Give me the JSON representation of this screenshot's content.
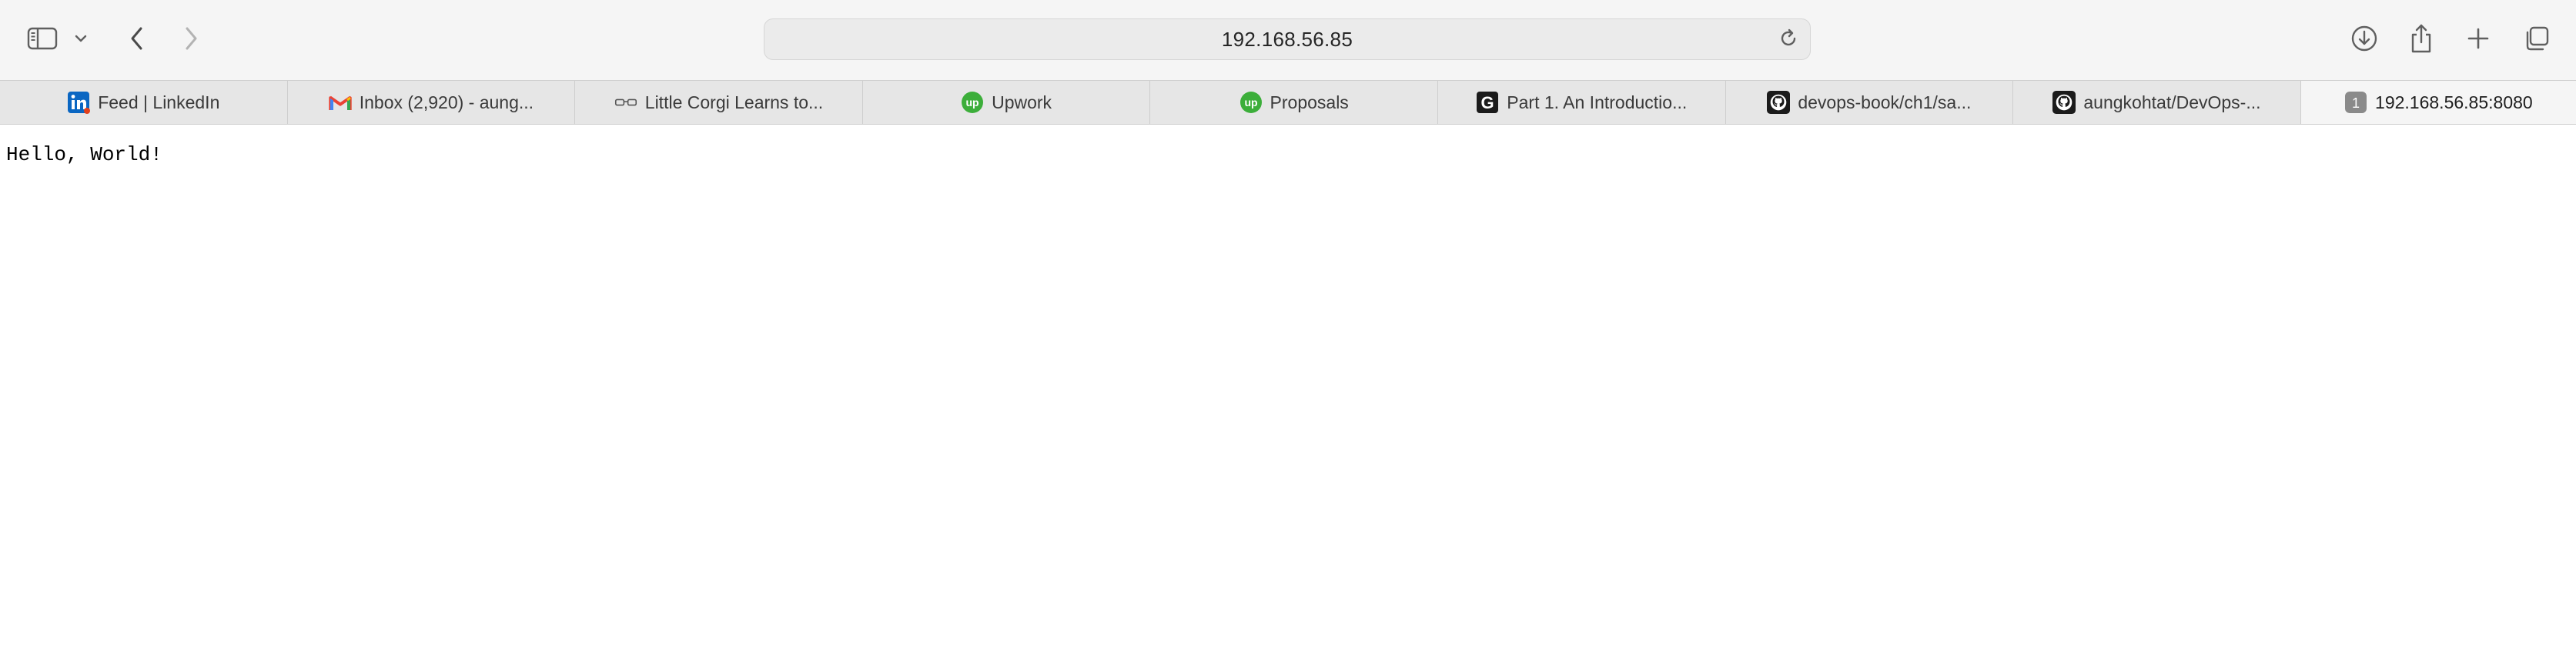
{
  "toolbar": {
    "sidebar_icon": "sidebar-icon",
    "sidebar_menu_icon": "chevron-down-icon",
    "back_icon": "chevron-left-icon",
    "forward_icon": "chevron-right-icon",
    "download_icon": "download-icon",
    "share_icon": "share-icon",
    "new_tab_icon": "plus-icon",
    "tab_overview_icon": "tab-overview-icon"
  },
  "address_bar": {
    "url": "192.168.56.85",
    "reload_icon": "reload-icon"
  },
  "tabs": [
    {
      "label": "Feed | LinkedIn",
      "icon": "linkedin-icon",
      "active": false
    },
    {
      "label": "Inbox (2,920) - aung...",
      "icon": "gmail-icon",
      "active": false
    },
    {
      "label": "Little Corgi Learns to...",
      "icon": "glasses-icon",
      "active": false
    },
    {
      "label": "Upwork",
      "icon": "upwork-icon",
      "active": false
    },
    {
      "label": "Proposals",
      "icon": "upwork-icon",
      "active": false
    },
    {
      "label": "Part 1. An Introductio...",
      "icon": "g-logo-icon",
      "active": false
    },
    {
      "label": "devops-book/ch1/sa...",
      "icon": "github-icon",
      "active": false
    },
    {
      "label": "aungkohtat/DevOps-...",
      "icon": "github-icon",
      "active": false
    },
    {
      "label": "192.168.56.85:8080",
      "icon": "number-badge-icon",
      "badge": "1",
      "active": true
    }
  ],
  "page": {
    "text": "Hello, World!"
  },
  "colors": {
    "upwork_green": "#3cae3a",
    "linkedin_blue": "#0a66c2",
    "gmail_red": "#ea4335",
    "toolbar_bg": "#f5f5f5",
    "tabbar_bg": "#e6e6e6"
  }
}
